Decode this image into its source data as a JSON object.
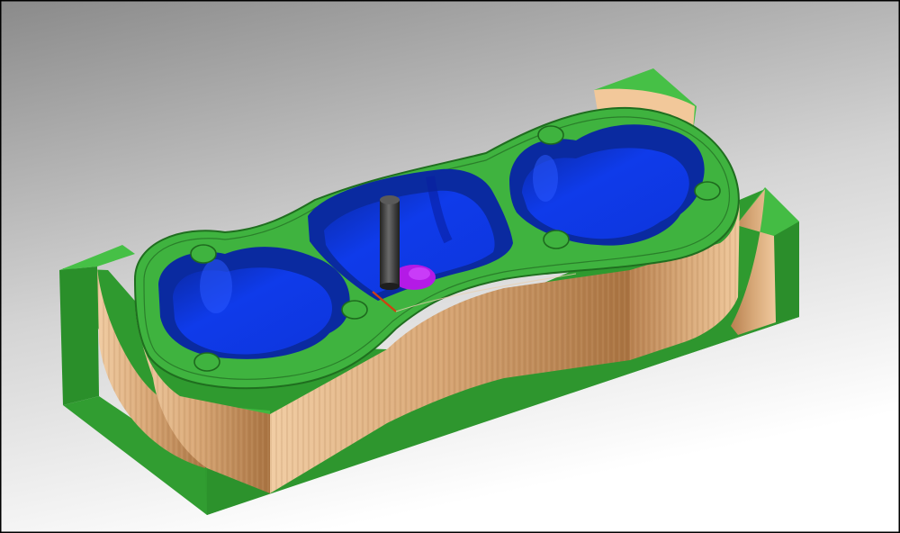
{
  "viewport": {
    "background_top": "#8f8f8f",
    "background_bottom": "#ffffff",
    "frame_color": "#000000"
  },
  "model": {
    "stock_color": "#3aae3a",
    "stock_dark": "#2f8f2f",
    "stock_light": "#48c448",
    "wall_color": "#d8ad82",
    "wall_shadow": "#b07a4c",
    "pocket_color": "#0c34d8",
    "pocket_deep": "#0a26a8",
    "pocket_light": "#2e5cff",
    "tool_color": "#3a3a3a",
    "tool_tip_color": "#b41ae6",
    "toolpath_color": "#d04010",
    "features": {
      "pockets": [
        "left-pocket",
        "center-pocket",
        "right-pocket"
      ],
      "holes": [
        "hole-top-left",
        "hole-bottom-left",
        "hole-mid-left",
        "hole-mid-right",
        "hole-top-right",
        "hole-right"
      ]
    }
  },
  "status": ""
}
